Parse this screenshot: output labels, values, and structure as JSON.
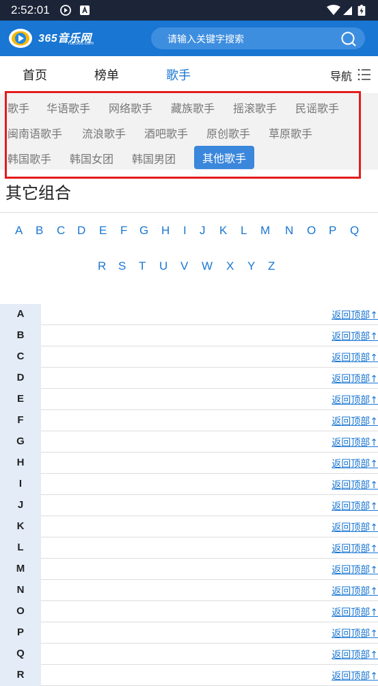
{
  "status": {
    "time": "2:52:01"
  },
  "header": {
    "logo_text": "365音乐网",
    "logo_sub": "Yue365.com",
    "search_placeholder": "请输入关键字搜索"
  },
  "nav": {
    "tabs": [
      {
        "label": "首页"
      },
      {
        "label": "榜单"
      },
      {
        "label": "歌手"
      }
    ],
    "menu_label": "导航"
  },
  "categories": [
    {
      "label": "歌手"
    },
    {
      "label": "华语歌手"
    },
    {
      "label": "网络歌手"
    },
    {
      "label": "藏族歌手"
    },
    {
      "label": "摇滚歌手"
    },
    {
      "label": "民谣歌手"
    },
    {
      "label": "闽南语歌手"
    },
    {
      "label": "流浪歌手"
    },
    {
      "label": "酒吧歌手"
    },
    {
      "label": "原创歌手"
    },
    {
      "label": "草原歌手"
    },
    {
      "label": "韩国歌手"
    },
    {
      "label": "韩国女团"
    },
    {
      "label": "韩国男团"
    },
    {
      "label": "其他歌手"
    }
  ],
  "page_title": "其它组合",
  "letters": [
    "A",
    "B",
    "C",
    "D",
    "E",
    "F",
    "G",
    "H",
    "I",
    "J",
    "K",
    "L",
    "M",
    "N",
    "O",
    "P",
    "Q",
    "R",
    "S",
    "T",
    "U",
    "V",
    "W",
    "X",
    "Y",
    "Z"
  ],
  "rows": [
    {
      "letter": "A",
      "back": "返回顶部↑"
    },
    {
      "letter": "B",
      "back": "返回顶部↑"
    },
    {
      "letter": "C",
      "back": "返回顶部↑"
    },
    {
      "letter": "D",
      "back": "返回顶部↑"
    },
    {
      "letter": "E",
      "back": "返回顶部↑"
    },
    {
      "letter": "F",
      "back": "返回顶部↑"
    },
    {
      "letter": "G",
      "back": "返回顶部↑"
    },
    {
      "letter": "H",
      "back": "返回顶部↑"
    },
    {
      "letter": "I",
      "back": "返回顶部↑"
    },
    {
      "letter": "J",
      "back": "返回顶部↑"
    },
    {
      "letter": "K",
      "back": "返回顶部↑"
    },
    {
      "letter": "L",
      "back": "返回顶部↑"
    },
    {
      "letter": "M",
      "back": "返回顶部↑"
    },
    {
      "letter": "N",
      "back": "返回顶部↑"
    },
    {
      "letter": "O",
      "back": "返回顶部↑"
    },
    {
      "letter": "P",
      "back": "返回顶部↑"
    },
    {
      "letter": "Q",
      "back": "返回顶部↑"
    },
    {
      "letter": "R",
      "back": "返回顶部↑"
    }
  ]
}
